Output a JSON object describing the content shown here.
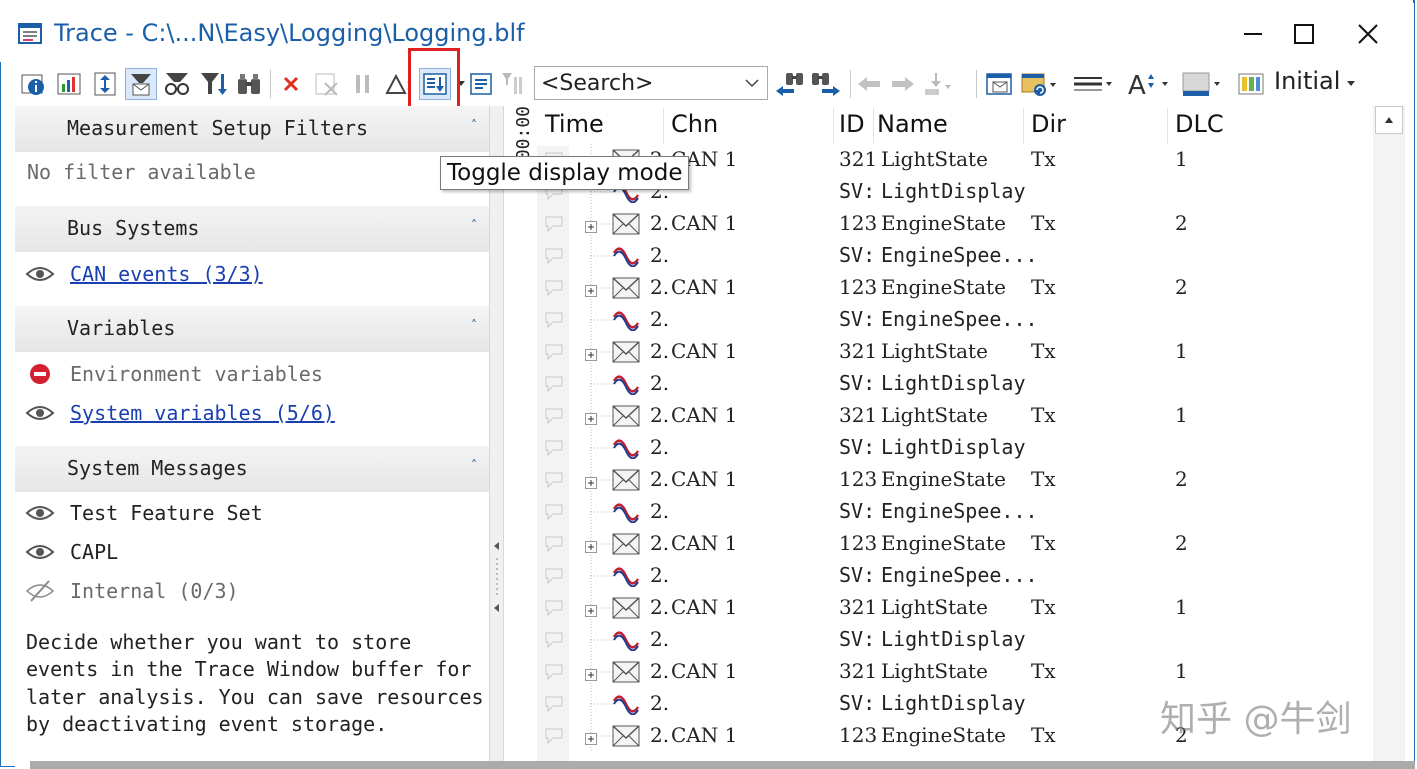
{
  "window": {
    "title": "Trace - C:\\...N\\Easy\\Logging\\Logging.blf"
  },
  "toolbar": {
    "search_placeholder": "<Search>",
    "layout_label": "Initial",
    "tooltip": "Toggle display mode",
    "left_buttons": [
      "info-icon",
      "statistics-icon",
      "scroll-toggle-icon",
      "message-filter-icon",
      "glasses-filter-icon",
      "filter-sort-icon",
      "binoculars-icon",
      "delete-icon",
      "clear-disabled-icon",
      "pause-icon",
      "delta-icon",
      "toggle-display-mode-icon",
      "detail-view-icon",
      "column-bar-icon"
    ],
    "right_buttons": [
      "find-previous-binoculars-icon",
      "find-next-binoculars-icon",
      "arrow-left-icon",
      "arrow-right-icon",
      "jump-icon",
      "window-message-icon",
      "window-refresh-icon",
      "line-style-icon",
      "font-size-icon",
      "color-theme-icon",
      "layout-icon"
    ]
  },
  "filters": {
    "sections": [
      {
        "title": "Measurement Setup Filters",
        "items": [
          {
            "icon": "none",
            "label": "No filter available",
            "style": "gray"
          }
        ]
      },
      {
        "title": "Bus Systems",
        "items": [
          {
            "icon": "eye-icon",
            "label": "CAN events (3/3)",
            "style": "link"
          }
        ]
      },
      {
        "title": "Variables",
        "items": [
          {
            "icon": "blocked-icon",
            "label": "Environment variables",
            "style": "gray"
          },
          {
            "icon": "eye-icon",
            "label": "System variables (5/6)",
            "style": "link"
          }
        ]
      },
      {
        "title": "System Messages",
        "items": [
          {
            "icon": "eye-icon",
            "label": "Test Feature Set",
            "style": "dark"
          },
          {
            "icon": "eye-icon",
            "label": "CAPL",
            "style": "dark"
          },
          {
            "icon": "eye-hidden-icon",
            "label": "Internal (0/3)",
            "style": "gray"
          }
        ]
      }
    ],
    "description": "Decide whether you want to store events in the Trace Window buffer for later analysis. You can save resources by deactivating event storage."
  },
  "trace": {
    "time_strip": "0:00:00",
    "columns": {
      "time": "Time",
      "chn": "Chn",
      "id": "ID",
      "name": "Name",
      "dir": "Dir",
      "dlc": "DLC"
    },
    "rows": [
      {
        "type": "msg",
        "time": "2.",
        "chn": "CAN 1",
        "id": "321",
        "name": "LightState",
        "dir": "Tx",
        "dlc": "1"
      },
      {
        "type": "sig",
        "time": "2.",
        "chn": "",
        "id": "SV:",
        "name": "LightDisplay",
        "dir": "",
        "dlc": ""
      },
      {
        "type": "msg",
        "time": "2.",
        "chn": "CAN 1",
        "id": "123",
        "name": "EngineState",
        "dir": "Tx",
        "dlc": "2"
      },
      {
        "type": "sig",
        "time": "2.",
        "chn": "",
        "id": "SV:",
        "name": "EngineSpee...",
        "dir": "",
        "dlc": ""
      },
      {
        "type": "msg",
        "time": "2.",
        "chn": "CAN 1",
        "id": "123",
        "name": "EngineState",
        "dir": "Tx",
        "dlc": "2"
      },
      {
        "type": "sig",
        "time": "2.",
        "chn": "",
        "id": "SV:",
        "name": "EngineSpee...",
        "dir": "",
        "dlc": ""
      },
      {
        "type": "msg",
        "time": "2.",
        "chn": "CAN 1",
        "id": "321",
        "name": "LightState",
        "dir": "Tx",
        "dlc": "1"
      },
      {
        "type": "sig",
        "time": "2.",
        "chn": "",
        "id": "SV:",
        "name": "LightDisplay",
        "dir": "",
        "dlc": ""
      },
      {
        "type": "msg",
        "time": "2.",
        "chn": "CAN 1",
        "id": "321",
        "name": "LightState",
        "dir": "Tx",
        "dlc": "1"
      },
      {
        "type": "sig",
        "time": "2.",
        "chn": "",
        "id": "SV:",
        "name": "LightDisplay",
        "dir": "",
        "dlc": ""
      },
      {
        "type": "msg",
        "time": "2.",
        "chn": "CAN 1",
        "id": "123",
        "name": "EngineState",
        "dir": "Tx",
        "dlc": "2"
      },
      {
        "type": "sig",
        "time": "2.",
        "chn": "",
        "id": "SV:",
        "name": "EngineSpee...",
        "dir": "",
        "dlc": ""
      },
      {
        "type": "msg",
        "time": "2.",
        "chn": "CAN 1",
        "id": "123",
        "name": "EngineState",
        "dir": "Tx",
        "dlc": "2"
      },
      {
        "type": "sig",
        "time": "2.",
        "chn": "",
        "id": "SV:",
        "name": "EngineSpee...",
        "dir": "",
        "dlc": ""
      },
      {
        "type": "msg",
        "time": "2.",
        "chn": "CAN 1",
        "id": "321",
        "name": "LightState",
        "dir": "Tx",
        "dlc": "1"
      },
      {
        "type": "sig",
        "time": "2.",
        "chn": "",
        "id": "SV:",
        "name": "LightDisplay",
        "dir": "",
        "dlc": ""
      },
      {
        "type": "msg",
        "time": "2.",
        "chn": "CAN 1",
        "id": "321",
        "name": "LightState",
        "dir": "Tx",
        "dlc": "1"
      },
      {
        "type": "sig",
        "time": "2.",
        "chn": "",
        "id": "SV:",
        "name": "LightDisplay",
        "dir": "",
        "dlc": ""
      },
      {
        "type": "msg",
        "time": "2.",
        "chn": "CAN 1",
        "id": "123",
        "name": "EngineState",
        "dir": "Tx",
        "dlc": "2"
      }
    ]
  },
  "watermark": "知乎 @牛剑",
  "colors": {
    "accent": "#1b5fa8",
    "highlight": "#e02020",
    "link": "#1a3fb0"
  }
}
